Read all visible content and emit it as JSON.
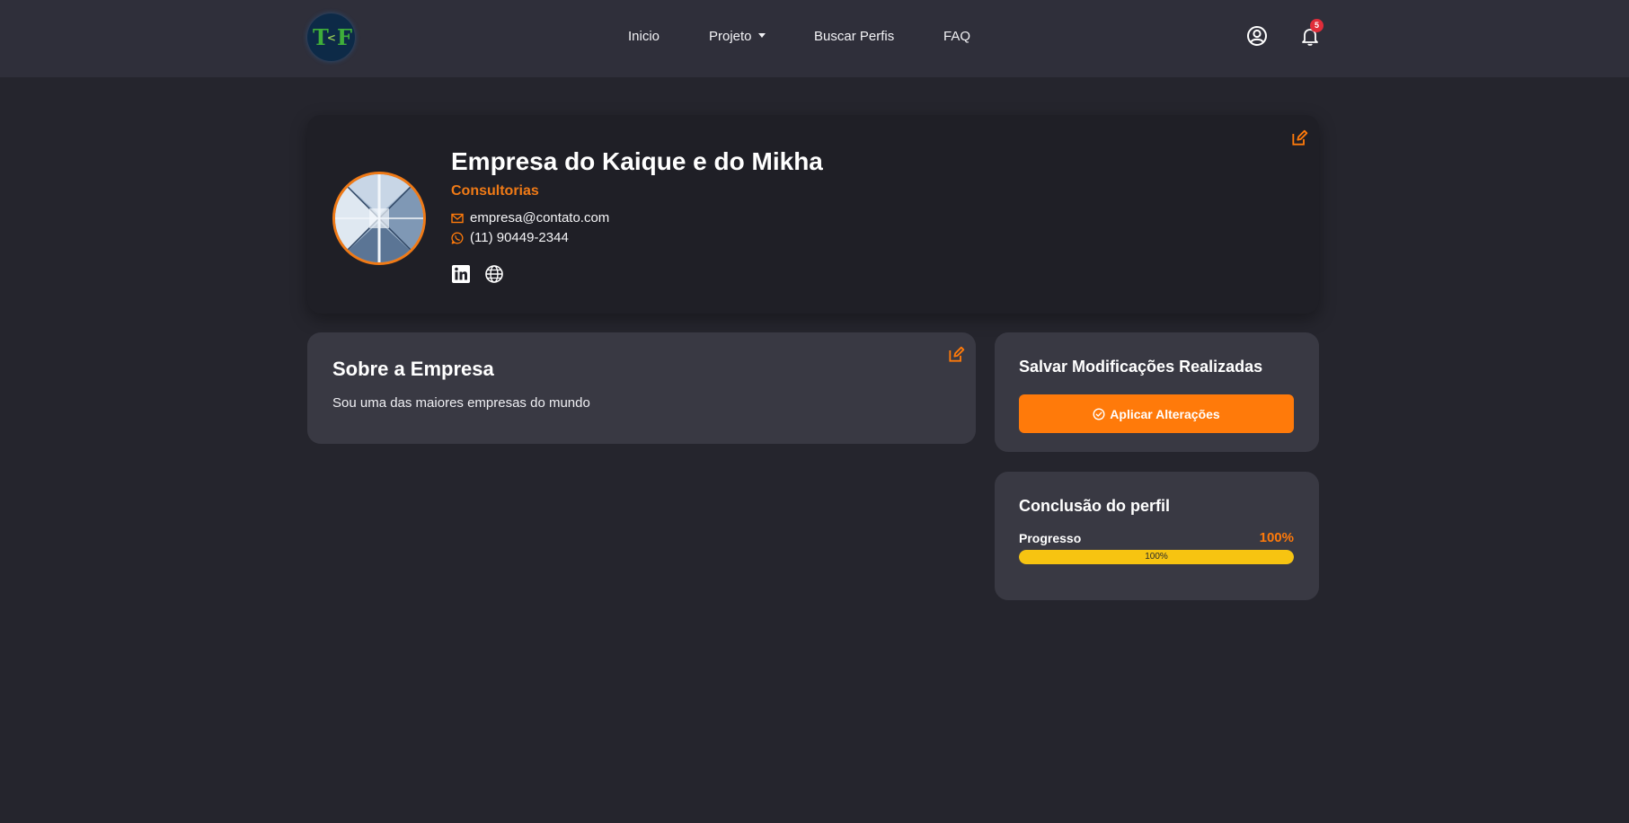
{
  "brand": {
    "logo_text_left": "T",
    "logo_text_sep": "<",
    "logo_text_right": "F"
  },
  "nav": {
    "items": [
      {
        "label": "Inicio"
      },
      {
        "label": "Projeto"
      },
      {
        "label": "Buscar Perfis"
      },
      {
        "label": "FAQ"
      }
    ],
    "notification_count": "5",
    "icons": {
      "user": "user-circle-icon",
      "bell": "bell-icon"
    }
  },
  "profile": {
    "name": "Empresa do Kaique e do Mikha",
    "category": "Consultorias",
    "email": "empresa@contato.com",
    "phone": "(11) 90449-2344",
    "social_icons": [
      "linkedin-icon",
      "globe-icon"
    ]
  },
  "about": {
    "title": "Sobre a Empresa",
    "text": "Sou uma das maiores empresas do mundo"
  },
  "save": {
    "title": "Salvar Modificações Realizadas",
    "button_label": "Aplicar Alterações"
  },
  "completion": {
    "title": "Conclusão do perfil",
    "progress_label": "Progresso",
    "percent_text": "100%",
    "bar_text": "100%",
    "value": 1.0
  },
  "colors": {
    "accent": "#ff7a0a",
    "progress": "#f7c411",
    "badge": "#e02d3a",
    "background": "#25252d"
  }
}
